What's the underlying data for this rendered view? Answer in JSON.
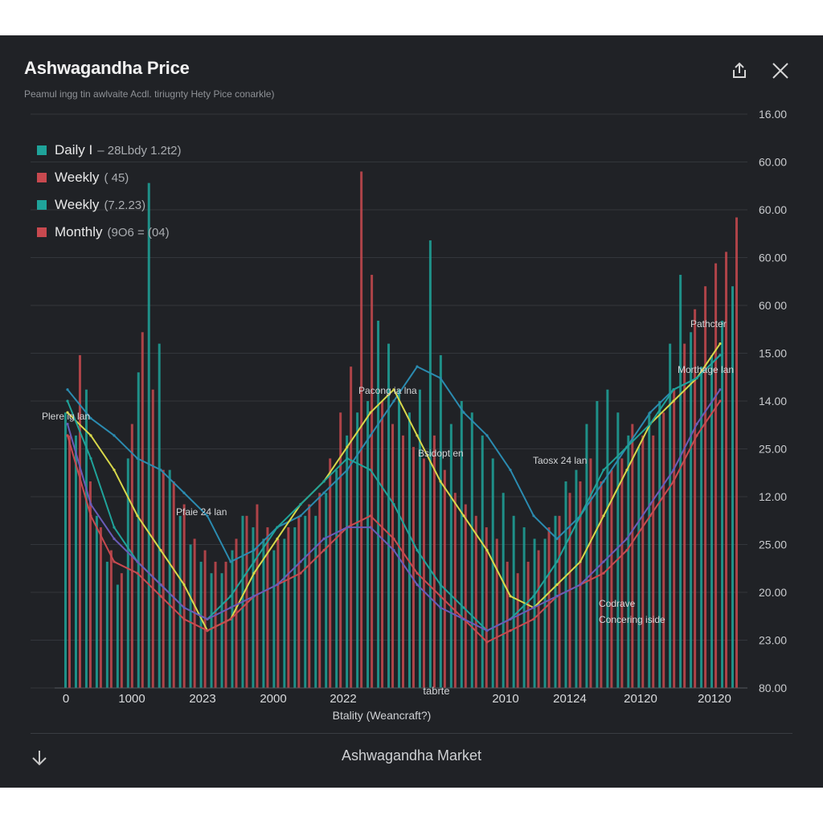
{
  "title": "Ashwagandha Price",
  "subtitle": "Peamul ingg tin awlvaite Acdl. tiriugnty Hety  Pice conarkle)",
  "footer": {
    "label": "Ashwagandha Market"
  },
  "icons": {
    "share": "share-icon",
    "close": "close-icon",
    "download": "arrow-down-icon"
  },
  "chart_data": {
    "type": "bar",
    "title": "Ashwagandha Price",
    "legend_position": "top-left",
    "grid": true,
    "legend": [
      {
        "name": "Daily I",
        "note": "– 28Lbdy  1.2t2)",
        "color": "#1fa39a"
      },
      {
        "name": "Weekly",
        "note": "( 45)",
        "color": "#c8494f"
      },
      {
        "name": "Weekly",
        "note": "(7.2.23)",
        "color": "#1fa39a"
      },
      {
        "name": "Monthly",
        "note": "(9O6 = (04)",
        "color": "#c8494f"
      }
    ],
    "y_tick_labels": [
      "16.00",
      "60.00",
      "60.00",
      "60.00",
      "60 00",
      "15.00",
      "14.00",
      "25.00",
      "12.00",
      "25.00",
      "20.00",
      "23.00",
      "80.00"
    ],
    "x_tick_labels": [
      "0",
      "1000",
      "2023",
      "2000",
      "2022",
      "2010",
      "20124",
      "20120",
      "20120"
    ],
    "xlabel": "Btality   (Weancraft?)",
    "x_annotation": "tabrte",
    "annotations": [
      {
        "text": "Plere ig lan"
      },
      {
        "text": "Pfaie 24 lan"
      },
      {
        "text": "Pacong ia lna"
      },
      {
        "text": "Bsidopt en"
      },
      {
        "text": "Taosx 24 lan"
      },
      {
        "text": "Pathcter"
      },
      {
        "text": "Morthage lan"
      },
      {
        "text": "Codrave"
      },
      {
        "text": "Concering iside"
      }
    ],
    "bars_teal": [
      48,
      44,
      52,
      30,
      22,
      18,
      40,
      55,
      88,
      60,
      38,
      30,
      25,
      22,
      20,
      20,
      24,
      30,
      28,
      26,
      24,
      26,
      28,
      30,
      30,
      34,
      38,
      44,
      48,
      50,
      64,
      60,
      52,
      48,
      52,
      78,
      58,
      46,
      50,
      48,
      44,
      40,
      34,
      30,
      28,
      26,
      26,
      30,
      36,
      38,
      46,
      50,
      52,
      48,
      44,
      42,
      48,
      50,
      60,
      72,
      62,
      56,
      58,
      64,
      70
    ],
    "bars_red": [
      44,
      58,
      36,
      28,
      24,
      20,
      46,
      62,
      52,
      38,
      36,
      32,
      26,
      24,
      22,
      22,
      26,
      30,
      32,
      28,
      26,
      28,
      30,
      32,
      34,
      40,
      48,
      56,
      90,
      72,
      50,
      46,
      44,
      42,
      40,
      44,
      38,
      34,
      32,
      30,
      28,
      26,
      22,
      20,
      22,
      24,
      28,
      30,
      34,
      36,
      40,
      36,
      38,
      40,
      46,
      44,
      44,
      48,
      52,
      60,
      66,
      70,
      74,
      76,
      82
    ],
    "series": [
      {
        "name": "Daily",
        "color": "#2b8bb0",
        "values": [
          52,
          47,
          44,
          40,
          38,
          34,
          30,
          22,
          24,
          28,
          30,
          34,
          38,
          44,
          50,
          56,
          54,
          48,
          44,
          38,
          30,
          26,
          30,
          36,
          42,
          48,
          52,
          54,
          58
        ]
      },
      {
        "name": "Weekly",
        "color": "#d8d84a",
        "values": [
          48,
          44,
          38,
          30,
          24,
          18,
          10,
          12,
          20,
          26,
          32,
          36,
          42,
          48,
          52,
          44,
          36,
          30,
          24,
          16,
          14,
          18,
          22,
          30,
          38,
          46,
          50,
          54,
          60
        ]
      },
      {
        "name": "Weekly",
        "color": "#1fa39a",
        "values": [
          50,
          40,
          28,
          22,
          18,
          14,
          12,
          16,
          22,
          28,
          32,
          36,
          40,
          38,
          32,
          24,
          18,
          14,
          10,
          12,
          16,
          22,
          30,
          38,
          42,
          46,
          52,
          54,
          58
        ]
      },
      {
        "name": "Monthly",
        "color": "#c8494f",
        "values": [
          44,
          30,
          22,
          20,
          16,
          12,
          10,
          12,
          16,
          18,
          20,
          24,
          28,
          30,
          26,
          20,
          16,
          12,
          8,
          10,
          12,
          16,
          18,
          20,
          24,
          30,
          36,
          44,
          50
        ]
      },
      {
        "name": "Monthly",
        "color": "#6a5bb8",
        "values": [
          46,
          32,
          26,
          22,
          18,
          14,
          12,
          14,
          16,
          18,
          22,
          26,
          28,
          28,
          24,
          18,
          14,
          12,
          10,
          12,
          14,
          16,
          18,
          22,
          26,
          32,
          38,
          46,
          52
        ]
      }
    ]
  }
}
